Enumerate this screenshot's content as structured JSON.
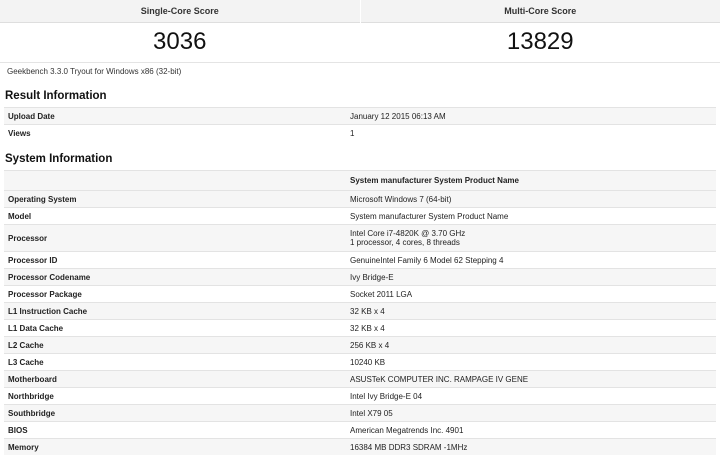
{
  "scores": {
    "single_label": "Single-Core Score",
    "single_value": "3036",
    "multi_label": "Multi-Core Score",
    "multi_value": "13829"
  },
  "subtitle": "Geekbench 3.3.0 Tryout for Windows x86 (32-bit)",
  "result": {
    "title": "Result Information",
    "rows": [
      {
        "k": "Upload Date",
        "v": "January 12 2015 06:13 AM"
      },
      {
        "k": "Views",
        "v": "1"
      }
    ]
  },
  "system": {
    "title": "System Information",
    "header": "System manufacturer System Product Name",
    "rows": [
      {
        "k": "Operating System",
        "v": "Microsoft Windows 7 (64-bit)"
      },
      {
        "k": "Model",
        "v": "System manufacturer System Product Name"
      },
      {
        "k": "Processor",
        "v": "Intel Core i7-4820K @ 3.70 GHz",
        "v2": "1 processor, 4 cores, 8 threads"
      },
      {
        "k": "Processor ID",
        "v": "GenuineIntel Family 6 Model 62 Stepping 4"
      },
      {
        "k": "Processor Codename",
        "v": "Ivy Bridge-E"
      },
      {
        "k": "Processor Package",
        "v": "Socket 2011 LGA"
      },
      {
        "k": "L1 Instruction Cache",
        "v": "32 KB x 4"
      },
      {
        "k": "L1 Data Cache",
        "v": "32 KB x 4"
      },
      {
        "k": "L2 Cache",
        "v": "256 KB x 4"
      },
      {
        "k": "L3 Cache",
        "v": "10240 KB"
      },
      {
        "k": "Motherboard",
        "v": "ASUSTeK COMPUTER INC. RAMPAGE IV GENE"
      },
      {
        "k": "Northbridge",
        "v": "Intel Ivy Bridge-E 04"
      },
      {
        "k": "Southbridge",
        "v": "Intel X79 05"
      },
      {
        "k": "BIOS",
        "v": "American Megatrends Inc. 4901"
      },
      {
        "k": "Memory",
        "v": "16384 MB DDR3 SDRAM -1MHz"
      }
    ]
  }
}
